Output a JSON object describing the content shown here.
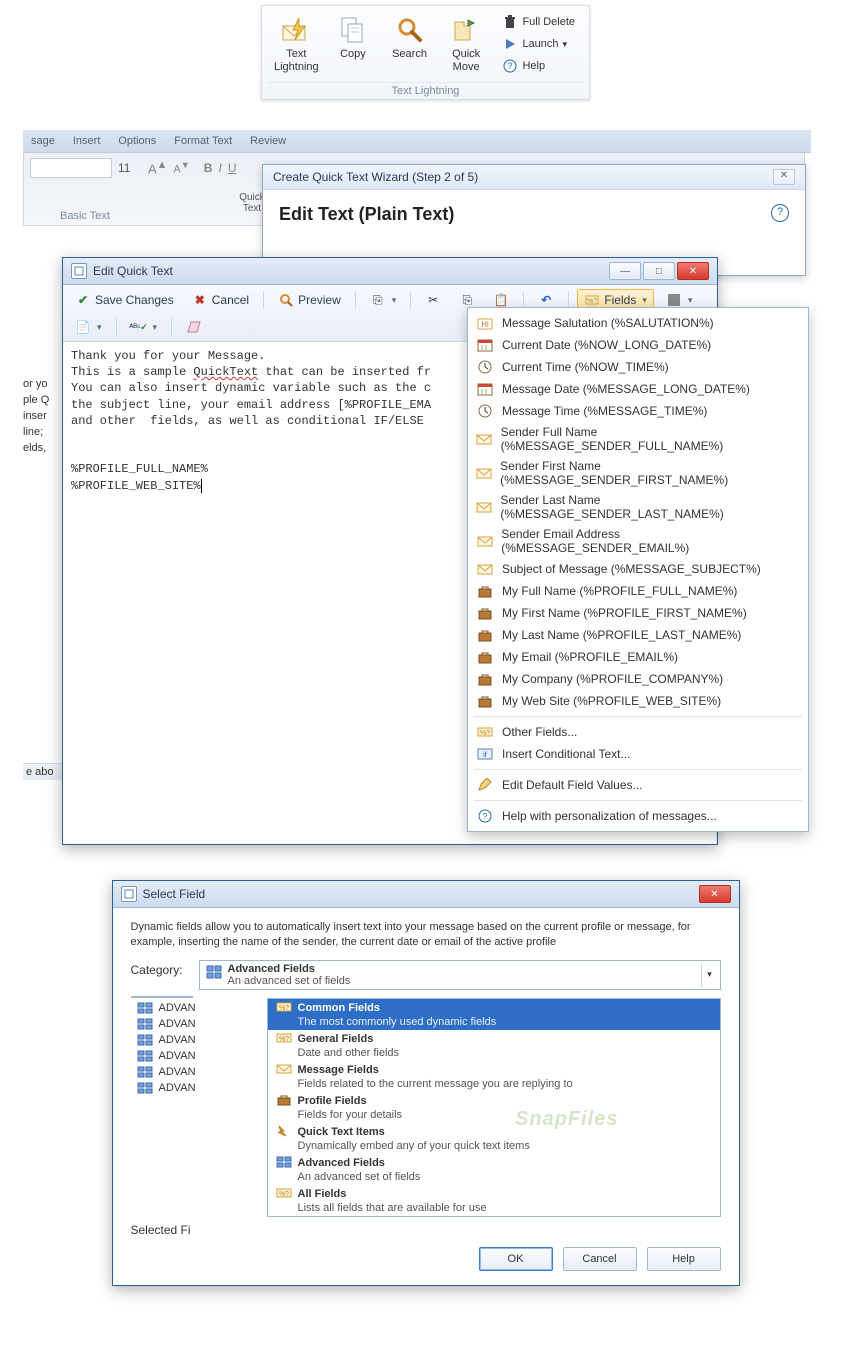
{
  "ribbon_top": {
    "buttons": {
      "text_lightning": "Text\nLightning",
      "copy": "Copy",
      "search": "Search",
      "quick_move": "Quick\nMove"
    },
    "small": {
      "full_delete": "Full Delete",
      "launch": "Launch",
      "help": "Help"
    },
    "group_caption": "Text Lightning"
  },
  "background": {
    "tabs": [
      "sage",
      "Insert",
      "Options",
      "Format Text",
      "Review"
    ],
    "font_size": "11",
    "caption": "Basic Text",
    "quicktext_label": "Quick\nText",
    "left_trunc": [
      "or yo",
      "ple Q",
      "inser",
      "line;",
      "elds,"
    ],
    "bottom": "e abo"
  },
  "wizard": {
    "title": "Create Quick Text Wizard (Step 2 of 5)",
    "heading": "Edit Text (Plain Text)"
  },
  "eqt": {
    "title": "Edit Quick Text",
    "toolbar": {
      "save": "Save Changes",
      "cancel": "Cancel",
      "preview": "Preview",
      "fields": "Fields"
    },
    "text_lines": [
      "Thank you for your Message.",
      "This is a sample QuickText that can be inserted fr",
      "You can also insert dynamic variable such as the c",
      "the subject line, your email address [%PROFILE_EMA",
      "and other  fields, as well as conditional IF/ELSE ",
      "",
      "",
      "%PROFILE_FULL_NAME%",
      "%PROFILE_WEB_SITE%"
    ]
  },
  "fields_menu": {
    "items": [
      {
        "label": "Message Salutation (%SALUTATION%)",
        "icon": "salutation"
      },
      {
        "label": "Current Date (%NOW_LONG_DATE%)",
        "icon": "calendar"
      },
      {
        "label": "Current Time (%NOW_TIME%)",
        "icon": "clock"
      },
      {
        "label": "Message Date (%MESSAGE_LONG_DATE%)",
        "icon": "calendar"
      },
      {
        "label": "Message Time (%MESSAGE_TIME%)",
        "icon": "clock"
      },
      {
        "label": "Sender Full Name (%MESSAGE_SENDER_FULL_NAME%)",
        "icon": "envelope"
      },
      {
        "label": "Sender First Name (%MESSAGE_SENDER_FIRST_NAME%)",
        "icon": "envelope"
      },
      {
        "label": "Sender Last Name (%MESSAGE_SENDER_LAST_NAME%)",
        "icon": "envelope"
      },
      {
        "label": "Sender Email Address (%MESSAGE_SENDER_EMAIL%)",
        "icon": "envelope"
      },
      {
        "label": "Subject of Message (%MESSAGE_SUBJECT%)",
        "icon": "envelope"
      },
      {
        "label": "My Full Name (%PROFILE_FULL_NAME%)",
        "icon": "briefcase"
      },
      {
        "label": "My First Name (%PROFILE_FIRST_NAME%)",
        "icon": "briefcase"
      },
      {
        "label": "My Last Name (%PROFILE_LAST_NAME%)",
        "icon": "briefcase"
      },
      {
        "label": "My Email (%PROFILE_EMAIL%)",
        "icon": "briefcase"
      },
      {
        "label": "My Company (%PROFILE_COMPANY%)",
        "icon": "briefcase"
      },
      {
        "label": "My Web Site (%PROFILE_WEB_SITE%)",
        "icon": "briefcase"
      }
    ],
    "extra": [
      {
        "label": "Other Fields...",
        "icon": "tag"
      },
      {
        "label": "Insert Conditional Text...",
        "icon": "cond"
      },
      {
        "label": "Edit Default Field Values...",
        "icon": "edit"
      },
      {
        "label": "Help with personalization of messages...",
        "icon": "help"
      }
    ]
  },
  "select_field": {
    "title": "Select Field",
    "desc": "Dynamic fields allow you to automatically insert text into your message based on the current profile or message, for example, inserting the name of the sender, the current date or email of the active profile",
    "category_label": "Category:",
    "selected_field_label": "Selected Fie",
    "selected_category": {
      "title": "Advanced Fields",
      "desc": "An advanced set of fields"
    },
    "list_rows": [
      "ADVAN",
      "ADVAN",
      "ADVAN",
      "ADVAN",
      "ADVAN",
      "ADVAN"
    ],
    "options": [
      {
        "title": "Common Fields",
        "desc": "The most commonly used dynamic fields",
        "selected": true,
        "icon": "tag"
      },
      {
        "title": "General Fields",
        "desc": "Date and other fields",
        "icon": "tag"
      },
      {
        "title": "Message Fields",
        "desc": "Fields related to the current message you are replying to",
        "icon": "envelope"
      },
      {
        "title": "Profile Fields",
        "desc": "Fields for your details",
        "icon": "briefcase"
      },
      {
        "title": "Quick Text Items",
        "desc": "Dynamically embed any of your quick text items",
        "icon": "quicktext"
      },
      {
        "title": "Advanced Fields",
        "desc": "An advanced set of fields",
        "icon": "advanced"
      },
      {
        "title": "All Fields",
        "desc": "Lists all fields that are available for use",
        "icon": "tag"
      }
    ],
    "buttons": {
      "ok": "OK",
      "cancel": "Cancel",
      "help": "Help"
    },
    "watermark": "SnapFiles"
  }
}
